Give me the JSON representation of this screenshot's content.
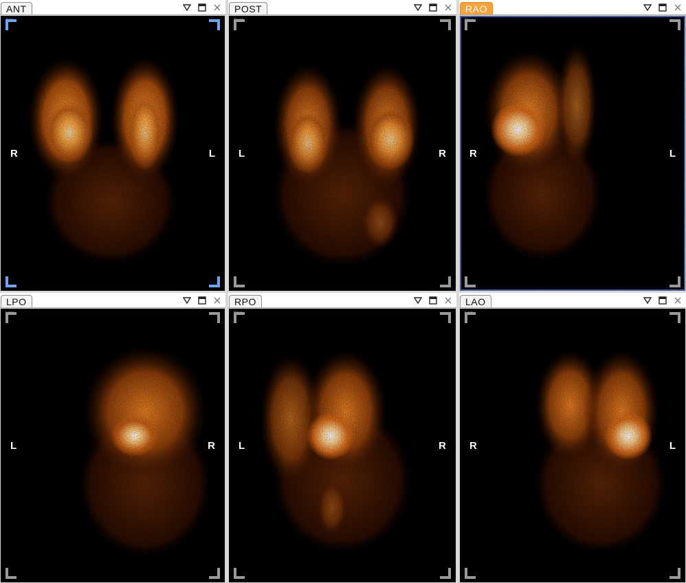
{
  "colors": {
    "accent_tab": "#f7a23a",
    "active_corner": "#6fa4f0",
    "inactive_corner": "#9a9a9a",
    "active_border": "#4f6fb5"
  },
  "icons": {
    "dropdown": "triangle-down-icon",
    "maximize": "maximize-icon",
    "close": "close-icon"
  },
  "viewports": [
    {
      "title": "ANT",
      "left": "R",
      "right": "L",
      "tiny": "Ant",
      "active": false,
      "selected_corners": true
    },
    {
      "title": "POST",
      "left": "L",
      "right": "R",
      "tiny": "Post",
      "active": false,
      "selected_corners": false
    },
    {
      "title": "RAO",
      "left": "R",
      "right": "L",
      "tiny": "Rao",
      "active": true,
      "selected_corners": false
    },
    {
      "title": "LPO",
      "left": "L",
      "right": "R",
      "tiny": "Lpo",
      "active": false,
      "selected_corners": false
    },
    {
      "title": "RPO",
      "left": "L",
      "right": "R",
      "tiny": "Rpo",
      "active": false,
      "selected_corners": false
    },
    {
      "title": "LAO",
      "left": "R",
      "right": "L",
      "tiny": "Lao",
      "active": false,
      "selected_corners": false
    }
  ]
}
